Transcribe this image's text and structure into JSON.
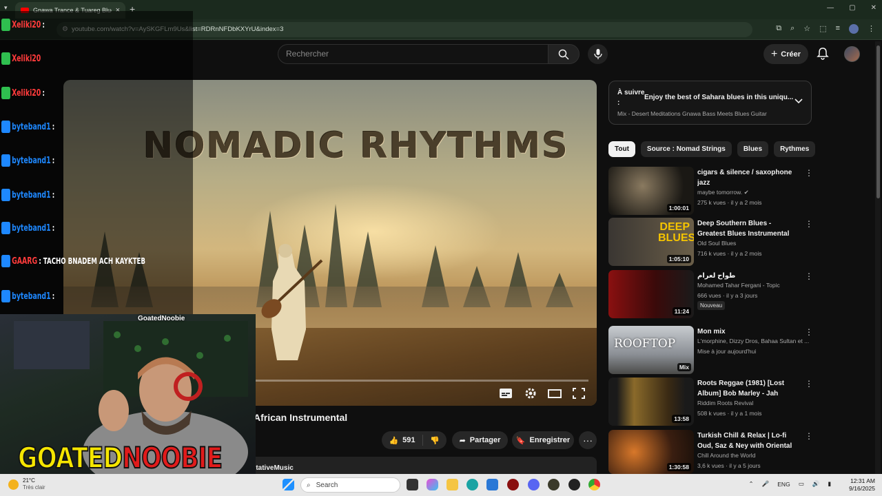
{
  "browser": {
    "tab_title": "Gnawa Trance & Tuareg Blues",
    "url": "youtube.com/watch?v=AySKGFLm9Us&list=RDRnNFDbKXYrU&index=3",
    "new_tab": "+",
    "tab_close": "×"
  },
  "header": {
    "search_placeholder": "Rechercher",
    "create_label": "Créer"
  },
  "video": {
    "overlay_title": "NOMADIC RHYTHMS",
    "title_partial": "African Instrumental",
    "likes": "591",
    "share_label": "Partager",
    "save_label": "Enregistrer",
    "more_label": "···",
    "hashtag": "#MeditativeMusic"
  },
  "up_next": {
    "label": "À suivre :",
    "title": "Enjoy the best of Sahara blues in this uniqu...",
    "subtitle": "Mix - Desert Meditations Gnawa Bass Meets Blues Guitar"
  },
  "chips": [
    "Tout",
    "Source : Nomad Strings",
    "Blues",
    "Rythmes"
  ],
  "recommendations": [
    {
      "title": "cigars & silence / saxophone jazz",
      "channel": "maybe tomorrow.",
      "stats": "275 k vues · il y a 2 mois",
      "duration": "1:00:01",
      "verified": true
    },
    {
      "title": "Deep Southern Blues - Greatest Blues Instrumental Music",
      "channel": "Old Soul Blues",
      "stats": "716 k vues · il y a 2 mois",
      "duration": "1:05:10",
      "thumb_text": "DEEP BLUES"
    },
    {
      "title": "طواح لعرام",
      "channel": "Mohamed Tahar Fergani - Topic",
      "stats": "666 vues · il y a 3 jours",
      "duration": "11:24",
      "badge": "Nouveau"
    },
    {
      "title": "Mon mix",
      "channel": "L'morphine, Dizzy Dros, Bahaa Sultan et ...",
      "stats": "Mise à jour aujourd'hui",
      "duration": "Mix",
      "thumb_text": "ROOFTOP"
    },
    {
      "title": "Roots Reggae (1981) [Lost Album] Bob Marley - Jah Bless...",
      "channel": "Riddim Roots Revival",
      "stats": "508 k vues · il y a 1 mois",
      "duration": "13:58"
    },
    {
      "title": "Turkish Chill & Relax | Lo-fi Oud, Saz & Ney with Oriental Vibes ...",
      "channel": "Chill Around the World",
      "stats": "3,6 k vues · il y a 5 jours",
      "duration": "1:30:58"
    }
  ],
  "chat": [
    {
      "user": "Xeliki20",
      "text": ":",
      "color": "#ff3b3b"
    },
    {
      "user": "Xeliki20",
      "text": "",
      "color": "#ff3b3b"
    },
    {
      "user": "Xeliki20",
      "text": ":",
      "color": "#ff3b3b"
    },
    {
      "user": "byteband1",
      "text": ":",
      "color": "#1e88ff"
    },
    {
      "user": "byteband1",
      "text": ":",
      "color": "#1e88ff"
    },
    {
      "user": "byteband1",
      "text": ":",
      "color": "#1e88ff"
    },
    {
      "user": "byteband1",
      "text": ":",
      "color": "#1e88ff"
    },
    {
      "user": "GAARG",
      "text": ": TACHO BNADEM ACH KAYKTEB",
      "color": "#ff3b3b"
    },
    {
      "user": "byteband1",
      "text": ":",
      "color": "#1e88ff"
    }
  ],
  "webcam": {
    "name": "GoatedNoobie",
    "logo_part1": "GOATED",
    "logo_part2": "NOOBIE"
  },
  "taskbar": {
    "temp": "21°C",
    "weather": "Très clair",
    "search": "Search",
    "lang": "ENG",
    "time": "12:31 AM",
    "date": "9/16/2025"
  },
  "colors": {
    "bg": "#0f0f0f",
    "accent_red": "#ff0000",
    "browser_frame": "#1b2a1e"
  }
}
